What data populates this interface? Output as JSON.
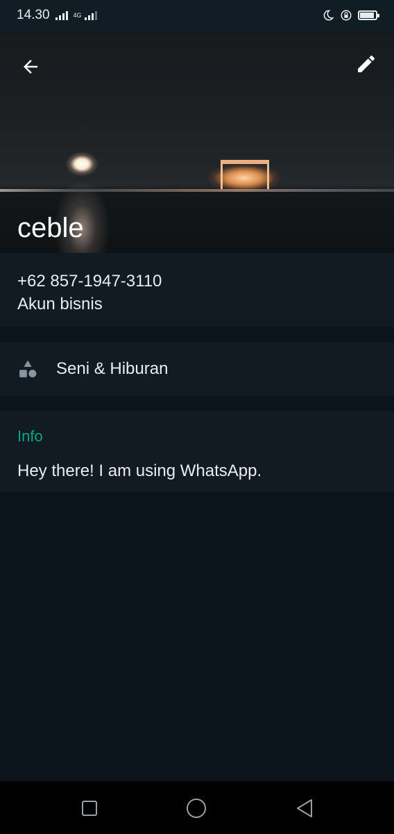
{
  "status_bar": {
    "time": "14.30",
    "network": "4G",
    "battery_level": 0.9
  },
  "profile": {
    "name": "ceble",
    "phone": "+62 857-1947-3110",
    "account_type": "Akun bisnis",
    "category": "Seni & Hiburan",
    "info_title": "Info",
    "info_text": "Hey there! I am using WhatsApp."
  },
  "colors": {
    "accent": "#00a884",
    "background": "#0b141a",
    "card": "#111b21",
    "statusbar": "#101d25"
  },
  "icons": [
    "back-arrow-icon",
    "edit-pencil-icon",
    "category-shapes-icon",
    "recent-apps-icon",
    "home-icon",
    "back-triangle-icon"
  ]
}
